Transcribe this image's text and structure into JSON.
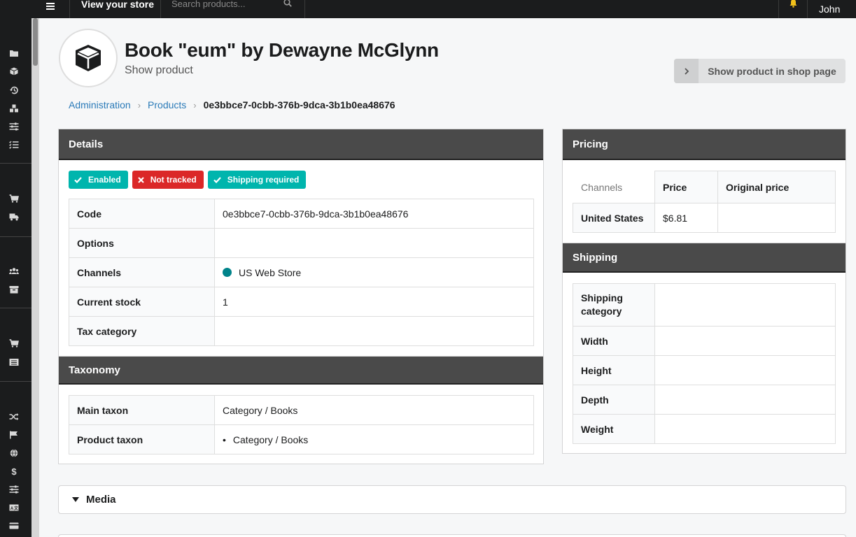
{
  "topbar": {
    "store_link": "View your store",
    "search_placeholder": "Search products...",
    "user": "John"
  },
  "sidebar": {
    "icons": [
      "folder-icon",
      "cube-icon",
      "history-icon",
      "cubes-icon",
      "sliders-icon",
      "tasks-icon",
      "cart-icon",
      "truck-icon",
      "users-icon",
      "archive-icon",
      "cart-arrow-icon",
      "list-icon",
      "shuffle-icon",
      "flag-icon",
      "globe-icon",
      "dollar-icon",
      "sliders-icon-2",
      "language-icon",
      "credit-card-icon"
    ]
  },
  "header": {
    "title": "Book \"eum\" by Dewayne McGlynn",
    "subtitle": "Show product",
    "shop_button": "Show product in shop page"
  },
  "breadcrumb": {
    "items": [
      "Administration",
      "Products"
    ],
    "current": "0e3bbce7-0cbb-376b-9dca-3b1b0ea48676"
  },
  "details": {
    "heading": "Details",
    "labels": [
      {
        "text": "Enabled",
        "color": "#00b5ad",
        "icon": "check-icon"
      },
      {
        "text": "Not tracked",
        "color": "#db2828",
        "icon": "x-icon"
      },
      {
        "text": "Shipping required",
        "color": "#00b5ad",
        "icon": "check-icon"
      }
    ],
    "rows": [
      {
        "key": "Code",
        "value": "0e3bbce7-0cbb-376b-9dca-3b1b0ea48676"
      },
      {
        "key": "Options",
        "value": ""
      },
      {
        "key": "Channels",
        "value": "US Web Store"
      },
      {
        "key": "Current stock",
        "value": "1"
      },
      {
        "key": "Tax category",
        "value": ""
      }
    ]
  },
  "taxonomy": {
    "heading": "Taxonomy",
    "rows": [
      {
        "key": "Main taxon",
        "value": "Category / Books"
      },
      {
        "key": "Product taxon",
        "value": "Category / Books"
      }
    ]
  },
  "pricing": {
    "heading": "Pricing",
    "columns": [
      "Channels",
      "Price",
      "Original price"
    ],
    "rows": [
      {
        "channel": "United States",
        "price": "$6.81",
        "original": ""
      }
    ]
  },
  "shipping": {
    "heading": "Shipping",
    "rows": [
      {
        "key": "Shipping category",
        "value": ""
      },
      {
        "key": "Width",
        "value": ""
      },
      {
        "key": "Height",
        "value": ""
      },
      {
        "key": "Depth",
        "value": ""
      },
      {
        "key": "Weight",
        "value": ""
      }
    ]
  },
  "media": {
    "heading": "Media"
  },
  "colors": {
    "teal": "#00b5ad",
    "red": "#db2828",
    "channel_dot": "#00838a",
    "link": "#2a7ab8"
  }
}
